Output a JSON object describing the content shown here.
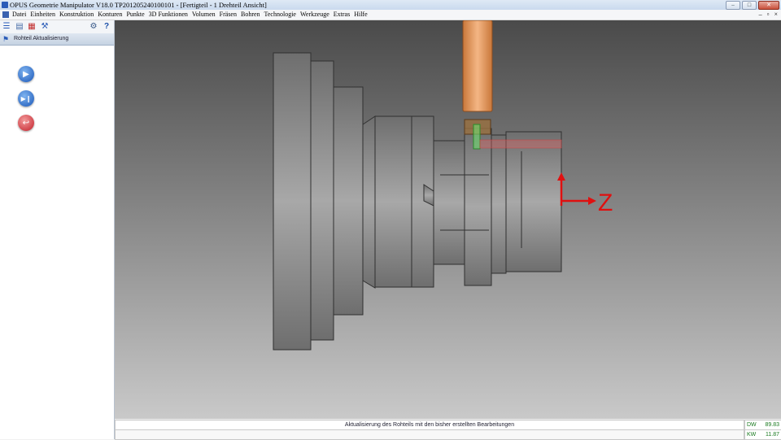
{
  "window": {
    "title": "OPUS Geometrie Manipulator V18.0   TP201205240100101  - [Fertigteil - 1 Drehteil Ansicht]",
    "minimize": "–",
    "maximize": "□",
    "close": "✕"
  },
  "menu": {
    "items": [
      "Datei",
      "Einheiten",
      "Konstruktion",
      "Konturen",
      "Punkte",
      "3D Funktionen",
      "Volumen",
      "Fräsen",
      "Bohren",
      "Technologie",
      "Werkzeuge",
      "Extras",
      "Hilfe"
    ],
    "mdi_minimize": "–",
    "mdi_restore": "▫",
    "mdi_close": "×"
  },
  "toolbar": {
    "help_glyph": "?"
  },
  "panel": {
    "title": "Rohteil Aktualisierung",
    "play_glyph": "▶",
    "step_glyph": "▶❙",
    "exit_glyph": "↩"
  },
  "viewport": {
    "axis_label": "Z",
    "colors": {
      "axis": "#e01010",
      "tool": "#e6a06a",
      "part": "#9a9a9a"
    }
  },
  "status": {
    "message": "Aktualisierung des Rohteils mit den bisher erstellten Bearbeitungen",
    "dw_label": "DW",
    "dw_value": "89.83",
    "kw_label": "KW",
    "kw_value": "11.87"
  }
}
